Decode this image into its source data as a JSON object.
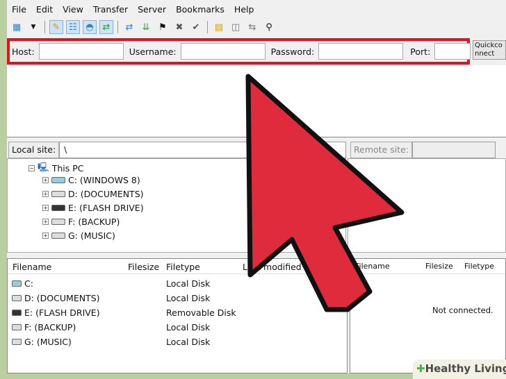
{
  "menu": [
    "File",
    "Edit",
    "View",
    "Transfer",
    "Server",
    "Bookmarks",
    "Help"
  ],
  "toolbar": {
    "icons": [
      "site-manager-icon",
      "dropdown-icon",
      "message-log-icon",
      "directory-tree-icon",
      "remote-tree-icon",
      "transfer-queue-icon",
      "refresh-icon",
      "process-queue-icon",
      "cancel-icon",
      "disconnect-icon",
      "reconnect-icon",
      "filter-icon",
      "compare-icon",
      "sync-browse-icon",
      "search-icon"
    ]
  },
  "quickconnect": {
    "host_label": "Host:",
    "host_value": "",
    "username_label": "Username:",
    "username_value": "",
    "password_label": "Password:",
    "password_value": "",
    "port_label": "Port:",
    "port_value": "",
    "button": "Quickconnect"
  },
  "local": {
    "site_label": "Local site:",
    "path": "\\",
    "tree": {
      "root": "This PC",
      "drives": [
        "C: (WINDOWS 8)",
        "D: (DOCUMENTS)",
        "E: (FLASH DRIVE)",
        "F: (BACKUP)",
        "G: (MUSIC)"
      ]
    },
    "columns": [
      "Filename",
      "Filesize",
      "Filetype",
      "Last modified"
    ],
    "files": [
      {
        "name": "C:",
        "type": "Local Disk"
      },
      {
        "name": "D: (DOCUMENTS)",
        "type": "Local Disk"
      },
      {
        "name": "E: (FLASH DRIVE)",
        "type": "Removable Disk"
      },
      {
        "name": "F: (BACKUP)",
        "type": "Local Disk"
      },
      {
        "name": "G: (MUSIC)",
        "type": "Local Disk"
      }
    ]
  },
  "remote": {
    "site_label": "Remote site:",
    "path": "",
    "columns": [
      "Filename",
      "Filesize",
      "Filetype"
    ],
    "status": "Not connected."
  },
  "watermark": {
    "brand": "Healthy Living"
  },
  "colors": {
    "highlight_box": "#e8101a",
    "arrow": "#e02b3c"
  }
}
